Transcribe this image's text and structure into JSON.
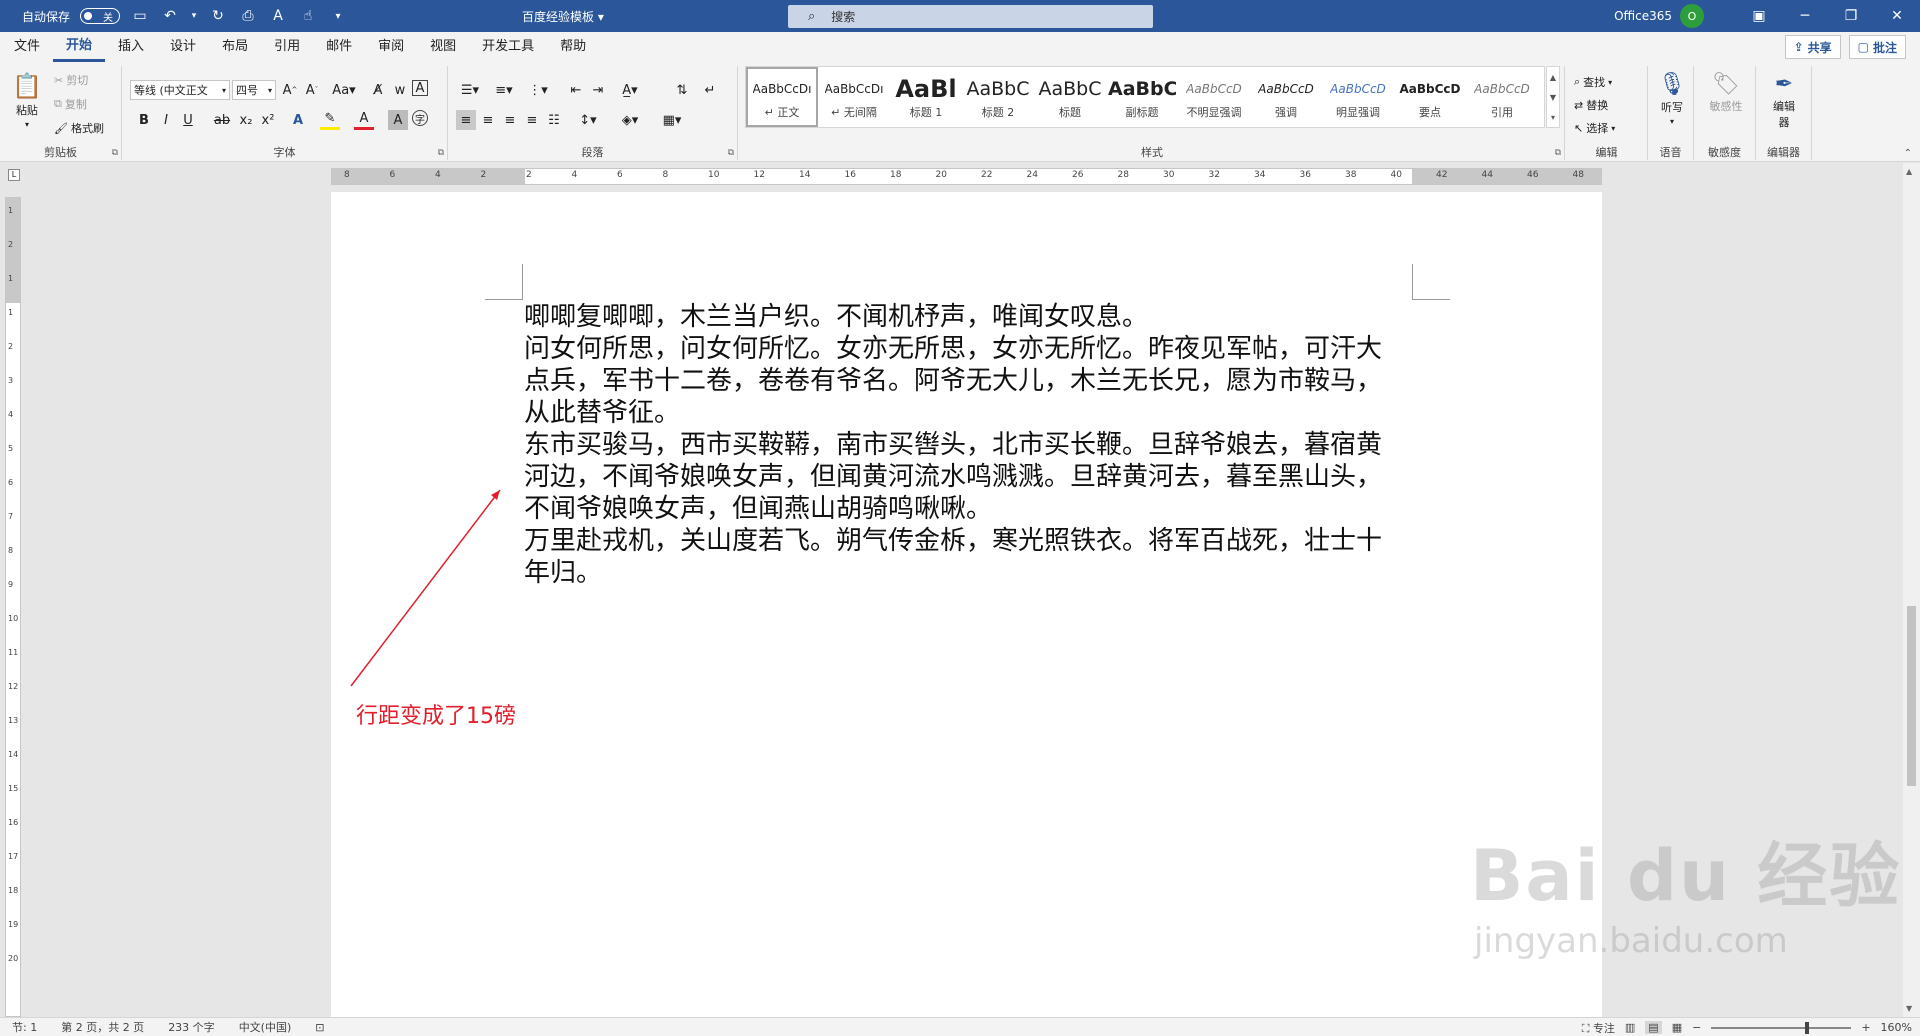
{
  "titlebar": {
    "autosave_label": "自动保存",
    "autosave_state": "关",
    "doc_title": "百度经验模板",
    "search_placeholder": "搜索",
    "account": "Office365",
    "avatar_initial": "O"
  },
  "tabs": [
    "文件",
    "开始",
    "插入",
    "设计",
    "布局",
    "引用",
    "邮件",
    "审阅",
    "视图",
    "开发工具",
    "帮助"
  ],
  "active_tab": "开始",
  "tabs_right": {
    "share": "共享",
    "comments": "批注"
  },
  "ribbon": {
    "clipboard": {
      "paste": "粘贴",
      "cut": "剪切",
      "copy": "复制",
      "format_painter": "格式刷",
      "label": "剪贴板"
    },
    "font": {
      "font_name": "等线 (中文正文",
      "font_size": "四号",
      "label": "字体"
    },
    "paragraph": {
      "label": "段落"
    },
    "styles": {
      "label": "样式",
      "items": [
        {
          "preview": "AaBbCcDı",
          "name": "↵ 正文"
        },
        {
          "preview": "AaBbCcDı",
          "name": "↵ 无间隔"
        },
        {
          "preview": "AaBl",
          "name": "标题 1"
        },
        {
          "preview": "AaBbC",
          "name": "标题 2"
        },
        {
          "preview": "AaBbC",
          "name": "标题"
        },
        {
          "preview": "AaBbC",
          "name": "副标题"
        },
        {
          "preview": "AaBbCcD",
          "name": "不明显强调"
        },
        {
          "preview": "AaBbCcD",
          "name": "强调"
        },
        {
          "preview": "AaBbCcD",
          "name": "明显强调"
        },
        {
          "preview": "AaBbCcD",
          "name": "要点"
        },
        {
          "preview": "AaBbCcD",
          "name": "引用"
        }
      ]
    },
    "editing": {
      "find": "查找",
      "replace": "替换",
      "select": "选择",
      "label": "编辑"
    },
    "voice": {
      "dictate": "听写",
      "label": "语音"
    },
    "sensitivity": {
      "button": "敏感性",
      "label": "敏感度"
    },
    "editor": {
      "button": "编辑器",
      "label": "编辑器"
    }
  },
  "ruler_numbers": [
    "8",
    "6",
    "4",
    "2",
    "2",
    "4",
    "6",
    "8",
    "10",
    "12",
    "14",
    "16",
    "18",
    "20",
    "22",
    "24",
    "26",
    "28",
    "30",
    "32",
    "34",
    "36",
    "38",
    "40",
    "42",
    "44",
    "46",
    "48"
  ],
  "vruler_numbers": [
    "1",
    "2",
    "1",
    "1",
    "2",
    "3",
    "4",
    "5",
    "6",
    "7",
    "8",
    "9",
    "10",
    "11",
    "12",
    "13",
    "14",
    "15",
    "16",
    "17",
    "18",
    "19",
    "20"
  ],
  "document": {
    "paragraphs": [
      "唧唧复唧唧，木兰当户织。不闻机杼声，唯闻女叹息。",
      "问女何所思，问女何所忆。女亦无所思，女亦无所忆。昨夜见军帖，可汗大点兵，军书十二卷，卷卷有爷名。阿爷无大儿，木兰无长兄，愿为市鞍马，从此替爷征。",
      "东市买骏马，西市买鞍鞯，南市买辔头，北市买长鞭。旦辞爷娘去，暮宿黄河边，不闻爷娘唤女声，但闻黄河流水鸣溅溅。旦辞黄河去，暮至黑山头，不闻爷娘唤女声，但闻燕山胡骑鸣啾啾。",
      "万里赴戎机，关山度若飞。朔气传金柝，寒光照铁衣。将军百战死，壮士十年归。"
    ]
  },
  "annotation": {
    "text": "行距变成了15磅",
    "color": "#e0202c"
  },
  "statusbar": {
    "section": "节: 1",
    "page": "第 2 页，共 2 页",
    "words": "233 个字",
    "language": "中文(中国)",
    "focus": "专注",
    "zoom": "160%"
  },
  "watermark": {
    "main": "Bai du 经验",
    "sub": "jingyan.baidu.com"
  },
  "colors": {
    "titlebar": "#2b579a",
    "accent": "#2b579a"
  }
}
